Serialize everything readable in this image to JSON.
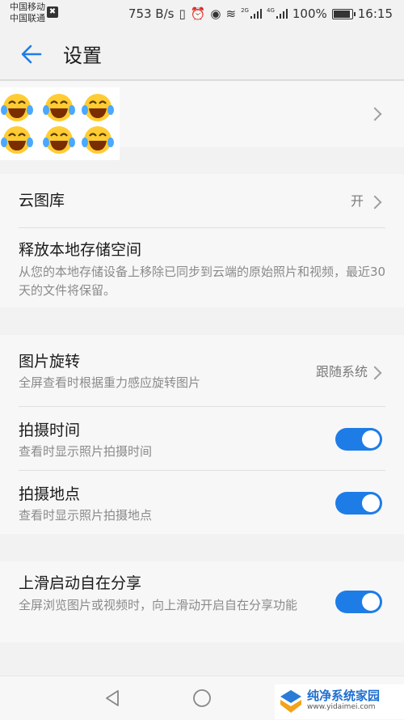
{
  "status_bar": {
    "carrier1": "中国移动",
    "carrier2": "中国联通",
    "sim_badge": "✖",
    "net_speed": "753 B/s",
    "net_type1": "2G",
    "net_type2": "4G",
    "battery_level_percent": 100,
    "battery_text": "100%",
    "time": "16:15"
  },
  "header": {
    "title": "设置",
    "back_icon": "back-arrow-icon",
    "accent_color": "#1e7ce6"
  },
  "sections": {
    "cloud": {
      "gallery_label": "云图库",
      "gallery_value": "开",
      "free_space_label": "释放本地存储空间",
      "free_space_desc": "从您的本地存储设备上移除已同步到云端的原始照片和视频，最近30天的文件将保留。"
    },
    "view": {
      "rotate_label": "图片旋转",
      "rotate_desc": "全屏查看时根据重力感应旋转图片",
      "rotate_value": "跟随系统",
      "time_label": "拍摄时间",
      "time_desc": "查看时显示照片拍摄时间",
      "time_on": true,
      "place_label": "拍摄地点",
      "place_desc": "查看时显示照片拍摄地点",
      "place_on": true
    },
    "share": {
      "label": "上滑启动自在分享",
      "desc": "全屏浏览图片或视频时，向上滑动开启自在分享功能",
      "on": true
    }
  },
  "watermark": {
    "name": "纯净系统家园",
    "url": "www.yidaimei.com"
  }
}
